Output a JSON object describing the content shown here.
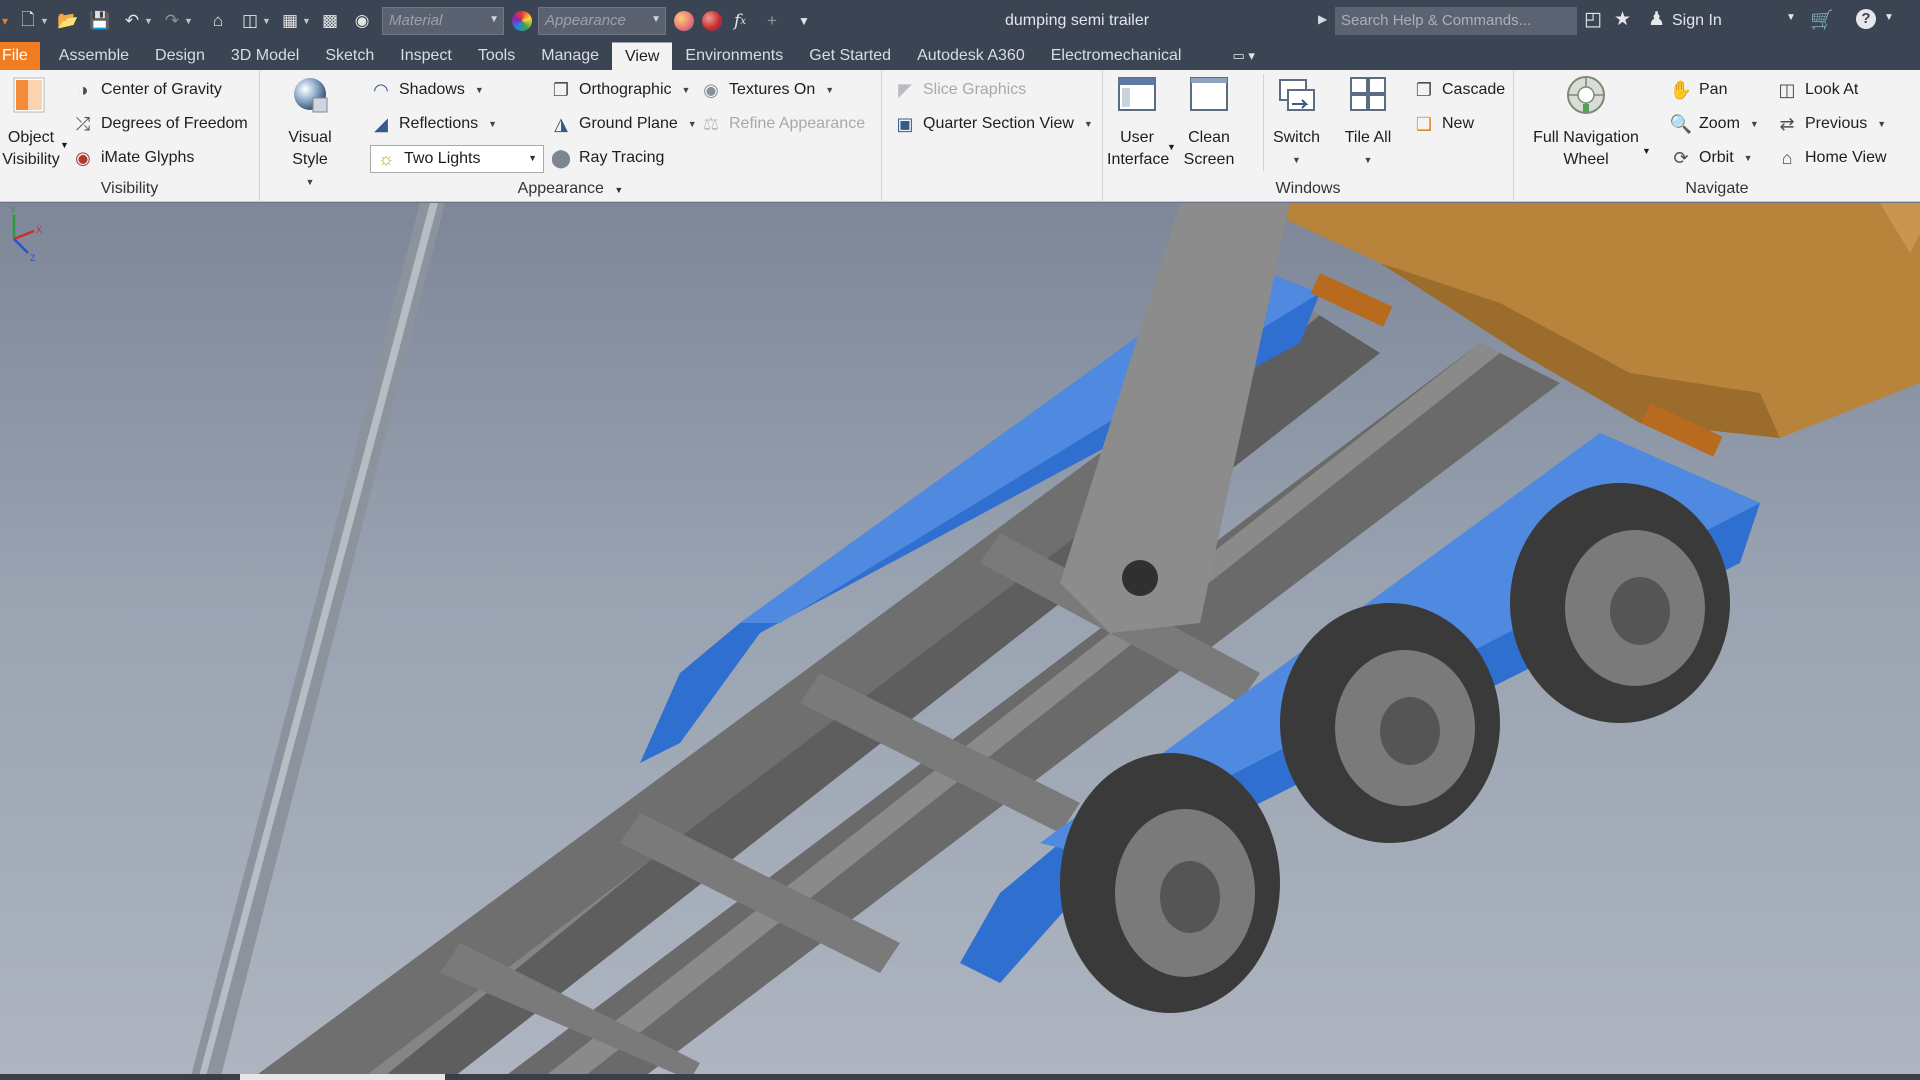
{
  "title_bar": {
    "document_title": "dumping semi trailer",
    "material_placeholder": "Material",
    "appearance_placeholder": "Appearance",
    "search_placeholder": "Search Help & Commands...",
    "sign_in": "Sign In",
    "help": "?"
  },
  "tabs": {
    "file": "File",
    "items": [
      "Assemble",
      "Design",
      "3D Model",
      "Sketch",
      "Inspect",
      "Tools",
      "Manage",
      "View",
      "Environments",
      "Get Started",
      "Autodesk A360",
      "Electromechanical"
    ],
    "active": "View"
  },
  "ribbon": {
    "visibility": {
      "title": "Visibility",
      "object_visibility_line1": "Object",
      "object_visibility_line2": "Visibility",
      "center_of_gravity": "Center of Gravity",
      "degrees_of_freedom": "Degrees of Freedom",
      "imate_glyphs": "iMate Glyphs"
    },
    "appearance": {
      "title": "Appearance",
      "visual_style_line1": "Visual Style",
      "shadows": "Shadows",
      "reflections": "Reflections",
      "lighting": "Two Lights",
      "orthographic": "Orthographic",
      "ground_plane": "Ground Plane",
      "ray_tracing": "Ray Tracing",
      "textures_on": "Textures On",
      "refine_appearance": "Refine Appearance",
      "slice_graphics": "Slice Graphics",
      "quarter_section_view": "Quarter Section View"
    },
    "windows": {
      "title": "Windows",
      "user_interface_line1": "User",
      "user_interface_line2": "Interface",
      "clean_screen_line1": "Clean",
      "clean_screen_line2": "Screen",
      "switch": "Switch",
      "tile_all": "Tile All",
      "cascade": "Cascade",
      "new": "New"
    },
    "navigate": {
      "title": "Navigate",
      "full_nav_line1": "Full Navigation",
      "full_nav_line2": "Wheel",
      "pan": "Pan",
      "zoom": "Zoom",
      "orbit": "Orbit",
      "look_at": "Look At",
      "previous": "Previous",
      "home_view": "Home View"
    }
  },
  "viewport": {
    "triad_labels": {
      "x": "X",
      "y": "Y",
      "z": "Z"
    }
  },
  "colors": {
    "titlebar_bg": "#3b4453",
    "file_tab": "#f07d22",
    "ribbon_bg": "#f3f3f3",
    "model_frame": "#6e6e6e",
    "model_fender": "#2f6fd0",
    "model_body": "#c58a3e"
  }
}
